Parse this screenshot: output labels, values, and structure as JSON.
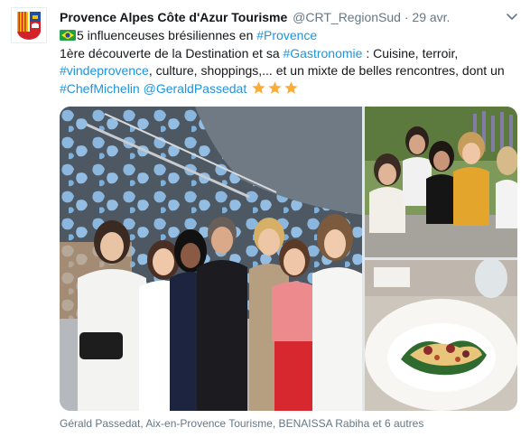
{
  "tweet": {
    "author_name": "Provence Alpes Côte d'Azur Tourisme",
    "handle": "@CRT_RegionSud",
    "separator": "·",
    "date": "29 avr.",
    "line1_text": "5 influenceuses brésiliennes en ",
    "line1_hashtag": "#Provence",
    "line2_text_a": "1ère découverte de la Destination et sa ",
    "line2_hashtag": "#Gastronomie",
    "line2_text_b": " : Cuisine, terroir,",
    "line3_hashtag": "#vindeprovence",
    "line3_text": ", culture, shoppings,... et un mixte de belles rencontres, dont un",
    "line4_hashtag": "#ChefMichelin",
    "line4_space": " ",
    "line4_mention": "@GeraldPassedat",
    "emoji_flag": "brazil-flag-icon",
    "emoji_stars": [
      "star-icon",
      "star-icon",
      "star-icon"
    ],
    "tagged_people": "Gérald Passedat, Aix-en-Provence Tourisme, BENAISSA Rabiha et 6 autres"
  },
  "colors": {
    "link": "#1b95e0",
    "secondary_text": "#657786",
    "primary_text": "#14171a",
    "star": "#ffac33"
  }
}
